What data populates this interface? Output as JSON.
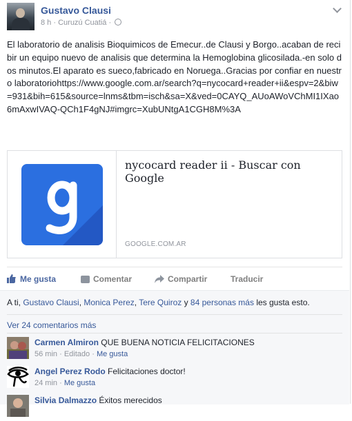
{
  "post": {
    "author": "Gustavo Clausi",
    "time": "8 h",
    "location": "Curuzú Cuatiá",
    "text": "El laboratorio de analisis Bioquimicos de Emecur..de Clausi y Borgo..acaban de recibir un equipo nuevo de analisis que determina la Hemoglobina glicosilada.-en solo dos minutos.El aparato es sueco,fabricado en Noruega..Gracias por confiar en nuestro laboratoriohttps://www.google.com.ar/search?q=nycocard+reader+ii&espv=2&biw=931&bih=615&source=lnms&tbm=isch&sa=X&ved=0CAYQ_AUoAWoVChMI1IXao6mAxwIVAQ-QCh1F4gNJ#imgrc=XubUNtgA1CGH8M%3A"
  },
  "link_card": {
    "title": "nycocard reader ii - Buscar con Google",
    "domain": "GOOGLE.COM.AR",
    "thumb_letter": "g"
  },
  "actions": {
    "like": "Me gusta",
    "comment": "Comentar",
    "share": "Compartir",
    "translate": "Traducir"
  },
  "likes": {
    "prefix": "A ti, ",
    "user1": "Gustavo Clausi",
    "sep1": ", ",
    "user2": "Monica Perez",
    "sep2": ", ",
    "user3": "Tere Quiroz",
    "and": " y ",
    "others": "84 personas más",
    "suffix": " les gusta esto."
  },
  "comments_more": "Ver 24 comentarios más",
  "comments": [
    {
      "name": "Carmen Almiron",
      "text": "QUE BUENA NOTICIA FELICITACIONES",
      "time": "56 min",
      "edited": "Editado",
      "like": "Me gusta"
    },
    {
      "name": "Angel Perez Rodo",
      "text": "Felicitaciones doctor!",
      "time": "24 min",
      "like": "Me gusta"
    },
    {
      "name": "Silvia Dalmazzo",
      "text": "Éxitos merecidos"
    }
  ],
  "colors": {
    "link": "#365899",
    "brand_blue": "#2b6fe0"
  }
}
